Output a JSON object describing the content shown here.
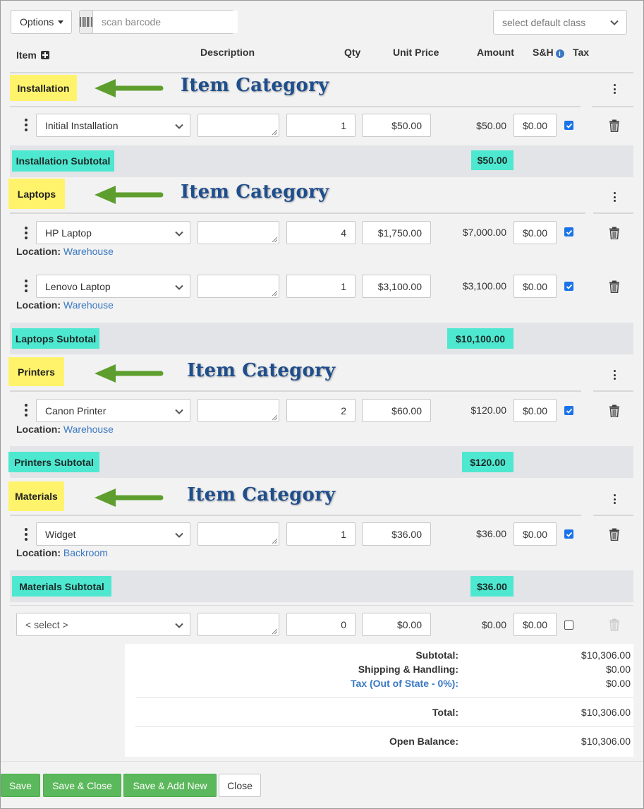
{
  "toolbar": {
    "options_label": "Options",
    "barcode_placeholder": "scan barcode",
    "default_class_placeholder": "select default class"
  },
  "columns": {
    "item": "Item",
    "description": "Description",
    "qty": "Qty",
    "unit_price": "Unit Price",
    "amount": "Amount",
    "sh": "S&H",
    "tax": "Tax"
  },
  "annotation_text": "Item Category",
  "location_label": "Location:",
  "categories": [
    {
      "name": "Installation",
      "subtotal_label": "Installation Subtotal",
      "subtotal": "$50.00",
      "lines": [
        {
          "item": "Initial Installation",
          "qty": "1",
          "unit_price": "$50.00",
          "amount": "$50.00",
          "sh": "$0.00",
          "tax": true,
          "location": ""
        }
      ]
    },
    {
      "name": "Laptops",
      "subtotal_label": "Laptops Subtotal",
      "subtotal": "$10,100.00",
      "lines": [
        {
          "item": "HP Laptop",
          "qty": "4",
          "unit_price": "$1,750.00",
          "amount": "$7,000.00",
          "sh": "$0.00",
          "tax": true,
          "location": "Warehouse"
        },
        {
          "item": "Lenovo Laptop",
          "qty": "1",
          "unit_price": "$3,100.00",
          "amount": "$3,100.00",
          "sh": "$0.00",
          "tax": true,
          "location": "Warehouse"
        }
      ]
    },
    {
      "name": "Printers",
      "subtotal_label": "Printers Subtotal",
      "subtotal": "$120.00",
      "lines": [
        {
          "item": "Canon Printer",
          "qty": "2",
          "unit_price": "$60.00",
          "amount": "$120.00",
          "sh": "$0.00",
          "tax": true,
          "location": "Warehouse"
        }
      ]
    },
    {
      "name": "Materials",
      "subtotal_label": "Materials Subtotal",
      "subtotal": "$36.00",
      "lines": [
        {
          "item": "Widget",
          "qty": "1",
          "unit_price": "$36.00",
          "amount": "$36.00",
          "sh": "$0.00",
          "tax": true,
          "location": "Backroom"
        }
      ]
    }
  ],
  "new_line": {
    "item": "< select >",
    "qty": "0",
    "unit_price": "$0.00",
    "amount": "$0.00",
    "sh": "$0.00",
    "tax": false
  },
  "totals": {
    "subtotal_label": "Subtotal:",
    "subtotal": "$10,306.00",
    "shipping_label": "Shipping & Handling:",
    "shipping": "$0.00",
    "tax_label": "Tax (Out of State - 0%):",
    "tax": "$0.00",
    "total_label": "Total:",
    "total": "$10,306.00",
    "open_balance_label": "Open Balance:",
    "open_balance": "$10,306.00"
  },
  "footer": {
    "save": "Save",
    "save_close": "Save & Close",
    "save_add_new": "Save & Add New",
    "close": "Close"
  },
  "colors": {
    "category_highlight": "#fff36b",
    "subtotal_highlight": "#4de8cf",
    "annotation_arrow": "#5e9e2e",
    "annotation_text": "#1f4e8c",
    "save_button": "#5cb85c",
    "link": "#3a78c2",
    "checkbox": "#1a73e8"
  }
}
